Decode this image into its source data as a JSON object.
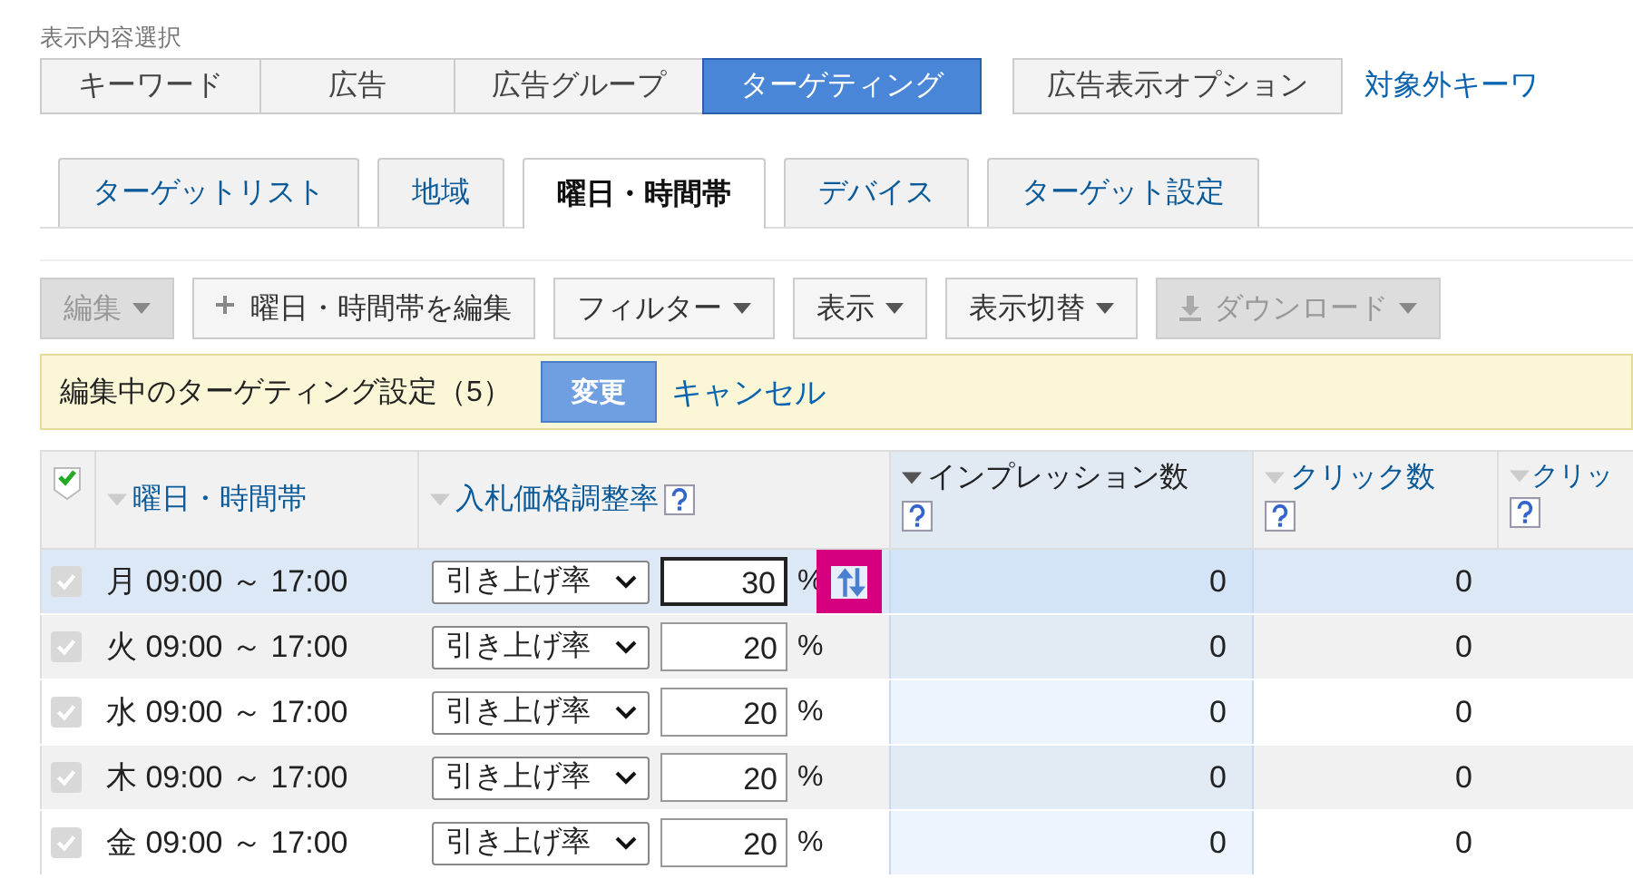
{
  "section_label": "表示内容選択",
  "view_tabs": [
    {
      "label": "キーワード",
      "selected": false,
      "kind": "main"
    },
    {
      "label": "広告",
      "selected": false,
      "kind": "main"
    },
    {
      "label": "広告グループ",
      "selected": false,
      "kind": "main"
    },
    {
      "label": "ターゲティング",
      "selected": true,
      "kind": "main"
    },
    {
      "label": "広告表示オプション",
      "selected": false,
      "kind": "extra"
    }
  ],
  "view_link": "対象外キーワ",
  "sub_tabs": [
    {
      "label": "ターゲットリスト",
      "selected": false
    },
    {
      "label": "地域",
      "selected": false
    },
    {
      "label": "曜日・時間帯",
      "selected": true
    },
    {
      "label": "デバイス",
      "selected": false
    },
    {
      "label": "ターゲット設定",
      "selected": false
    }
  ],
  "toolbar": [
    {
      "label": "編集",
      "kind": "menu",
      "disabled": true
    },
    {
      "label": "曜日・時間帯を編集",
      "kind": "add",
      "disabled": false
    },
    {
      "label": "フィルター",
      "kind": "menu",
      "disabled": false
    },
    {
      "label": "表示",
      "kind": "menu",
      "disabled": false
    },
    {
      "label": "表示切替",
      "kind": "menu",
      "disabled": false
    },
    {
      "label": "ダウンロード",
      "kind": "download",
      "disabled": true
    }
  ],
  "edit_bar": {
    "message": "編集中のターゲティング設定（5）",
    "apply": "変更",
    "cancel": "キャンセル"
  },
  "table": {
    "select_all_checked": true,
    "columns": [
      {
        "label": "曜日・時間帯",
        "sorted": false,
        "help": false
      },
      {
        "label": "入札価格調整率",
        "sorted": false,
        "help": true
      },
      {
        "label": "インプレッション数",
        "sorted": true,
        "help": true
      },
      {
        "label": "クリック数",
        "sorted": false,
        "help": true
      },
      {
        "label": "クリッ",
        "sorted": false,
        "help": true
      }
    ],
    "rows": [
      {
        "checked": true,
        "selected": true,
        "schedule": "月 09:00 ～ 17:00",
        "adjust": "引き上げ率",
        "rate": "30",
        "unit": "%",
        "impressions": "0",
        "clicks": "0"
      },
      {
        "checked": true,
        "selected": false,
        "schedule": "火 09:00 ～ 17:00",
        "adjust": "引き上げ率",
        "rate": "20",
        "unit": "%",
        "impressions": "0",
        "clicks": "0"
      },
      {
        "checked": true,
        "selected": false,
        "schedule": "水 09:00 ～ 17:00",
        "adjust": "引き上げ率",
        "rate": "20",
        "unit": "%",
        "impressions": "0",
        "clicks": "0"
      },
      {
        "checked": true,
        "selected": false,
        "schedule": "木 09:00 ～ 17:00",
        "adjust": "引き上げ率",
        "rate": "20",
        "unit": "%",
        "impressions": "0",
        "clicks": "0"
      },
      {
        "checked": true,
        "selected": false,
        "schedule": "金 09:00 ～ 17:00",
        "adjust": "引き上げ率",
        "rate": "20",
        "unit": "%",
        "impressions": "0",
        "clicks": "0"
      }
    ]
  }
}
